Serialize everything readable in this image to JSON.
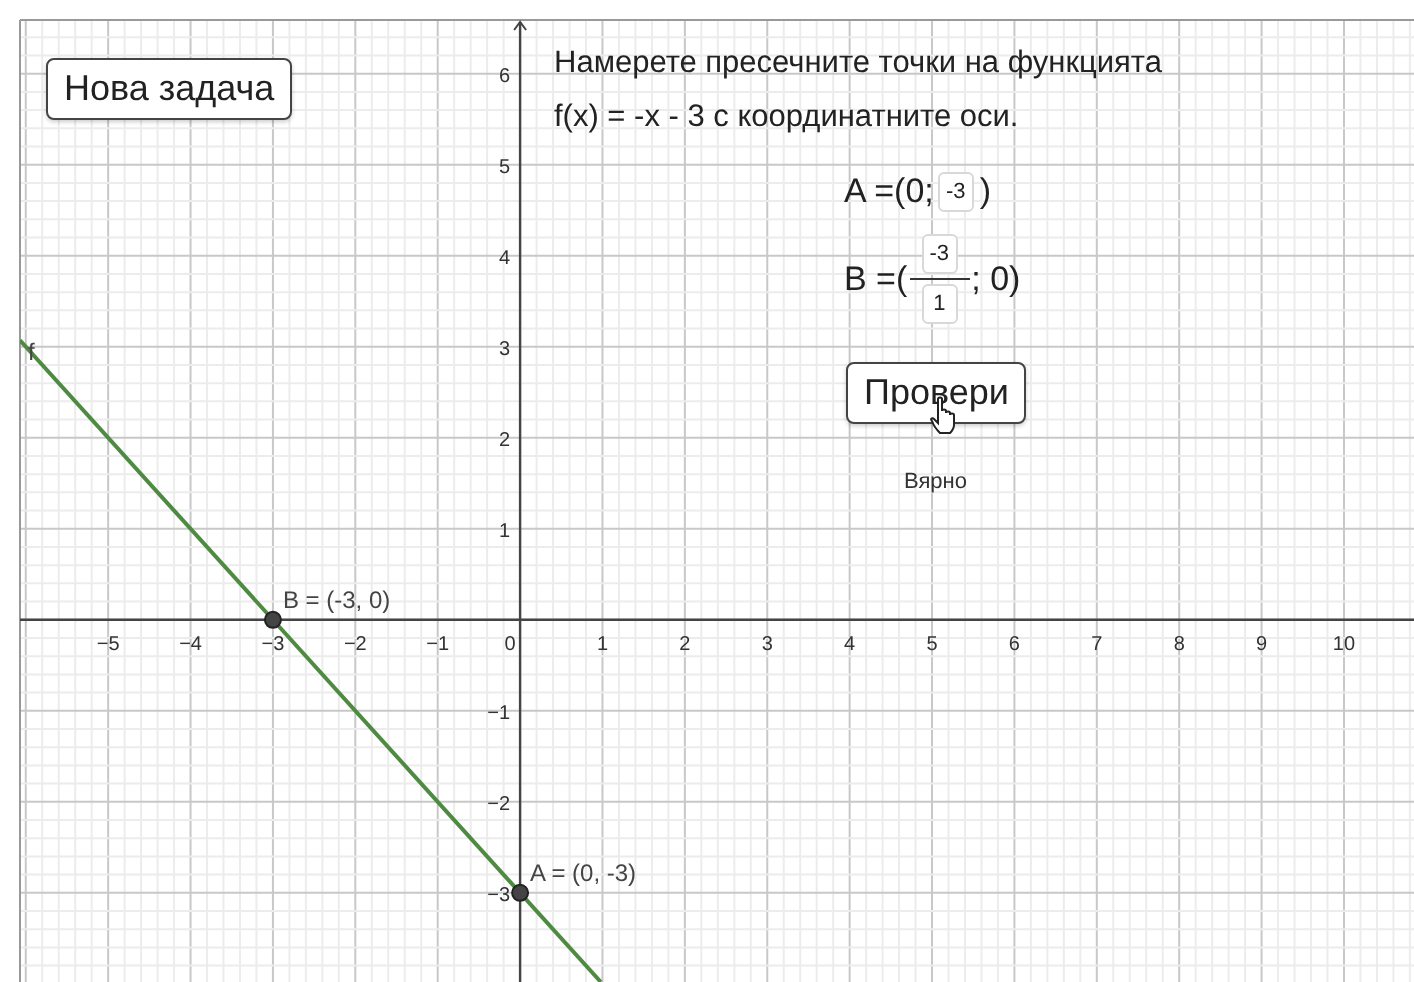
{
  "new_task_button": "Нова задача",
  "instructions": [
    "Намерете пресечните точки на функцията",
    "f(x) = -x - 3 с координатните оси."
  ],
  "answer_a": {
    "prefix": "A =(0;",
    "value": "-3",
    "suffix": ")"
  },
  "answer_b": {
    "prefix": "B =(",
    "numerator": "-3",
    "denominator": "1",
    "suffix": "; 0)"
  },
  "check_button": "Провери",
  "feedback": "Вярно",
  "graph": {
    "chart_data": {
      "type": "line",
      "x": [
        -6.07,
        0.98
      ],
      "grid": true,
      "series": [
        {
          "name": "f",
          "color": "#4f8a43",
          "values": [
            3.07,
            -3.98
          ]
        }
      ],
      "xlim": [
        -6.07,
        10.85
      ],
      "ylim": [
        -3.98,
        6.59
      ],
      "xticks": [
        {
          "value": -5,
          "label": "−5"
        },
        {
          "value": -4,
          "label": "−4"
        },
        {
          "value": -3,
          "label": "−3"
        },
        {
          "value": -2,
          "label": "−2"
        },
        {
          "value": -1,
          "label": "−1"
        },
        {
          "value": 0,
          "label": "0"
        },
        1,
        2,
        3,
        4,
        5,
        6,
        7,
        8,
        9,
        10
      ],
      "yticks": [
        {
          "value": -3,
          "label": "−3"
        },
        {
          "value": -2,
          "label": "−2"
        },
        {
          "value": -1,
          "label": "−1"
        },
        1,
        2,
        3,
        4,
        5,
        6
      ],
      "annotations": [
        {
          "x": -3,
          "y": 0,
          "text": "B = (-3, 0)"
        },
        {
          "x": 0,
          "y": -3,
          "text": "A = (0, -3)"
        }
      ]
    }
  }
}
